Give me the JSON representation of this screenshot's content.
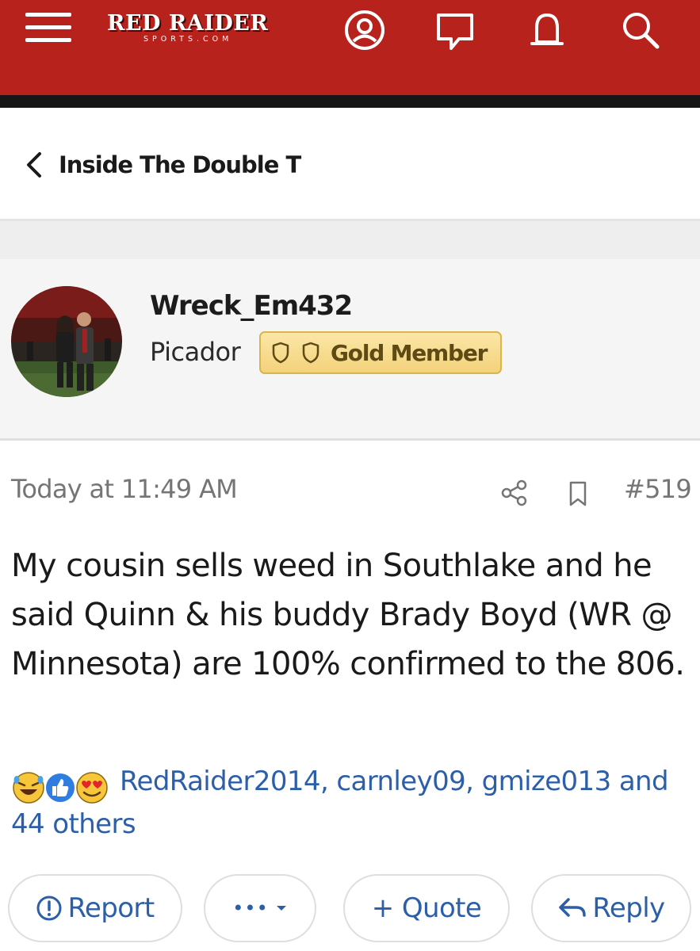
{
  "header": {
    "logo_main": "RED RAIDER",
    "logo_sub": "SPORTS.COM",
    "brand_color": "#b8221c",
    "icons": [
      "menu-icon",
      "account-icon",
      "messages-icon",
      "alerts-icon",
      "search-icon"
    ]
  },
  "breadcrumb": {
    "label": "Inside The Double T"
  },
  "post": {
    "author": "Wreck_Em432",
    "user_title": "Picador",
    "badge": "Gold Member",
    "timestamp": "Today at 11:49 AM",
    "post_number": "#519",
    "body": "My cousin sells weed in Southlake and he said Quinn & his buddy Brady Boyd (WR @ Minnesota) are 100% confirmed to the 806.",
    "reaction_icons": [
      "laughing-emoji-icon",
      "like-icon",
      "love-emoji-icon"
    ],
    "reactions_line1": "RedRaider2014, carnley09, gmize013 and",
    "reactions_line2": "44 others"
  },
  "actions": {
    "report": "Report",
    "more": "•••",
    "quote": "+ Quote",
    "reply": "Reply"
  }
}
